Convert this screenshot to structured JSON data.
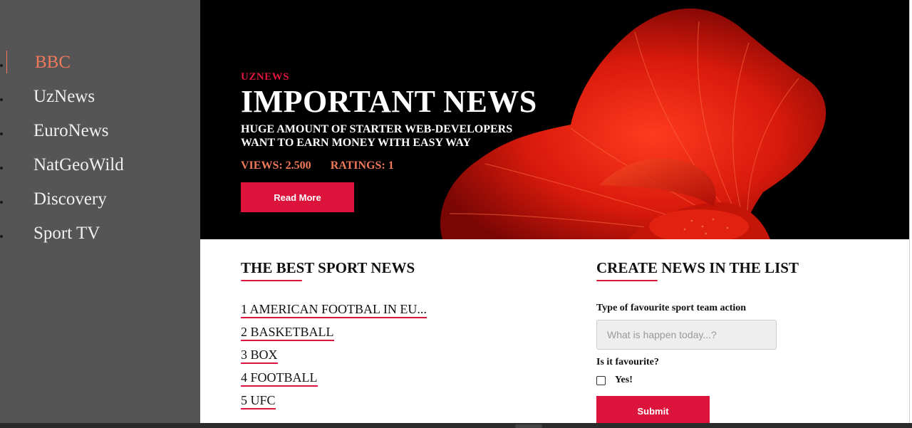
{
  "sidebar": {
    "items": [
      {
        "label": "BBC",
        "active": true
      },
      {
        "label": "UzNews",
        "active": false
      },
      {
        "label": "EuroNews",
        "active": false
      },
      {
        "label": "NatGeoWild",
        "active": false
      },
      {
        "label": "Discovery",
        "active": false
      },
      {
        "label": "Sport TV",
        "active": false
      }
    ]
  },
  "hero": {
    "eyebrow": "UZNEWS",
    "headline": "IMPORTANT NEWS",
    "sub_line1": "HUGE AMOUNT OF STARTER WEB-DEVELOPERS",
    "sub_line2": "WANT TO EARN MONEY WITH EASY WAY",
    "views": "VIEWS: 2.500",
    "ratings": "RATINGS: 1",
    "read_more_label": "Read More",
    "image_icon": "red-betta-fish-image"
  },
  "sport_news": {
    "title": "THE BEST SPORT NEWS",
    "items": [
      "1 AMERICAN FOOTBAL IN EU...",
      "2 BASKETBALL",
      "3 BOX",
      "4 FOOTBALL",
      "5 UFC"
    ]
  },
  "create_form": {
    "title": "CREATE NEWS IN THE LIST",
    "field_label": "Type of favourite sport team action",
    "field_placeholder": "What is happen today...?",
    "field_value": "",
    "favourite_label": "Is it favourite?",
    "checkbox_label": "Yes!",
    "checkbox_checked": false,
    "submit_label": "Submit"
  },
  "colors": {
    "accent": "#dc143c",
    "active_nav": "#f0795a",
    "sidebar_bg": "#555555",
    "hero_bg": "#000000"
  }
}
